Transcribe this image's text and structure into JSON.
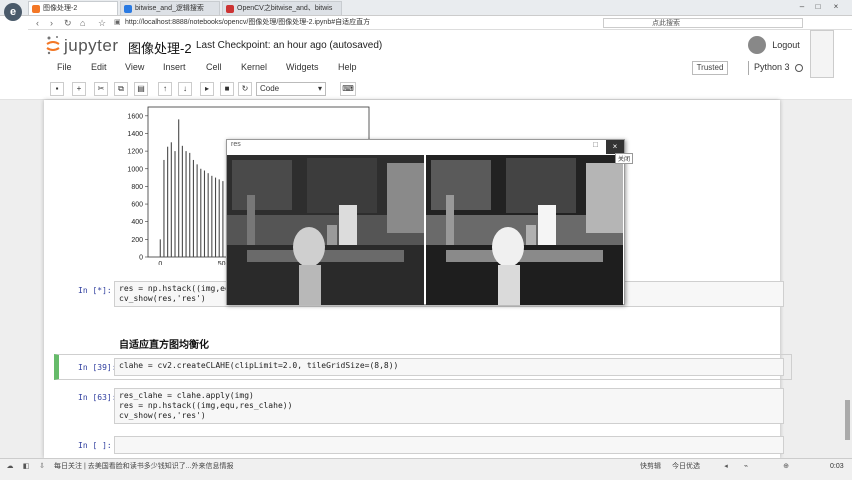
{
  "browser": {
    "logo_letter": "e",
    "tabs": [
      {
        "label": "图像处理-2",
        "active": true
      },
      {
        "label": "bitwise_and_逻辑搜索"
      },
      {
        "label": "OpenCV之bitwise_and、bitwis"
      }
    ],
    "url": "http://localhost:8888/notebooks/opencv/图像处理/图像处理-2.ipynb#自适应直方",
    "search_placeholder": "点此搜索"
  },
  "jupyter": {
    "logo_text": "jupyter",
    "notebook_title": "图像处理-2",
    "checkpoint": "Last Checkpoint: an hour ago (autosaved)",
    "logout": "Logout",
    "menu": [
      "File",
      "Edit",
      "View",
      "Insert",
      "Cell",
      "Kernel",
      "Widgets",
      "Help"
    ],
    "trusted": "Trusted",
    "kernel": "Python 3",
    "cell_type": "Code"
  },
  "chart_data": {
    "type": "bar",
    "title": "",
    "xlabel": "",
    "ylabel": "",
    "ylim": [
      0,
      1700
    ],
    "yticks": [
      "0",
      "200",
      "400",
      "600",
      "800",
      "1000",
      "1200",
      "1400",
      "1600"
    ],
    "xticks": [
      "0",
      "50"
    ],
    "x": [
      0,
      3,
      6,
      9,
      12,
      15,
      18,
      21,
      24,
      27,
      30,
      33,
      36,
      39,
      42,
      45,
      48,
      51,
      54,
      57,
      60
    ],
    "values": [
      200,
      1100,
      1250,
      1300,
      1200,
      1560,
      1260,
      1200,
      1180,
      1100,
      1050,
      1000,
      980,
      950,
      920,
      900,
      880,
      860,
      850,
      830,
      800
    ]
  },
  "cells": [
    {
      "prompt": "In [*]:",
      "code": [
        "res = np.hstack((img,equ))",
        "cv_show(res,'res')"
      ]
    },
    {
      "heading": "自适应直方图均衡化"
    },
    {
      "prompt": "In [39]:",
      "code": [
        "clahe = cv2.createCLAHE(clipLimit=2.0, tileGridSize=(8,8))"
      ]
    },
    {
      "prompt": "In [63]:",
      "code": [
        "res_clahe = clahe.apply(img)",
        "res = np.hstack((img,equ,res_clahe))",
        "cv_show(res,'res')"
      ]
    },
    {
      "prompt": "In [ ]:",
      "code": [
        ""
      ]
    }
  ],
  "image_window": {
    "title": "res",
    "close_tooltip": "关闭"
  },
  "taskbar": {
    "status_text": "每日关注 | 去美国看脸和读书多少钱知识了...外来信息情报",
    "clock": "0:03",
    "right_items": [
      "快剪辑",
      "今日优选"
    ]
  }
}
